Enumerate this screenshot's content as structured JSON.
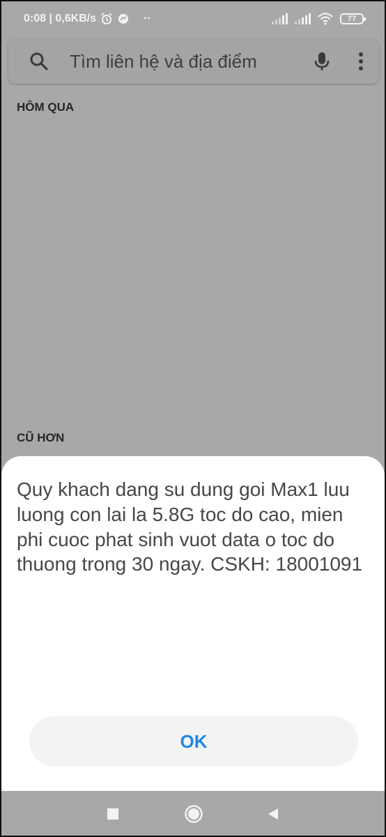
{
  "status_bar": {
    "time_speed": "0:08 | 0,6KB/s",
    "dots": "··",
    "battery": "77"
  },
  "search": {
    "placeholder": "Tìm liên hệ và địa điểm"
  },
  "sections": {
    "yesterday": "HÔM QUA",
    "older": "CŨ HƠN"
  },
  "dialog": {
    "message": "Quy khach dang su dung goi Max1 luu luong con lai la 5.8G toc do cao, mien phi cuoc phat sinh vuot data o toc do thuong trong 30 ngay. CSKH: 18001091",
    "ok_label": "OK"
  },
  "colors": {
    "accent": "#1e88e5",
    "scrim": "#a8a8a8"
  },
  "icons": {
    "search": "search-icon",
    "mic": "mic-icon",
    "more": "more-vert-icon",
    "recents": "square-icon",
    "home": "circle-icon",
    "back": "triangle-back-icon"
  }
}
